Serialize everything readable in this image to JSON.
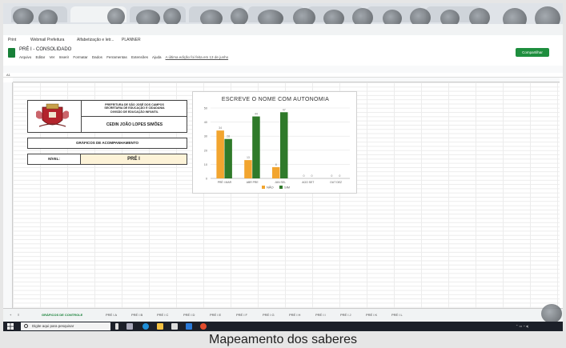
{
  "bookmarks": {
    "items": [
      "Print",
      "Webmail Prefeitura",
      "Alfabetização e letr...",
      "PLANNER"
    ]
  },
  "spreadsheet": {
    "title": "PRÉ I - CONSOLIDADO",
    "menu": [
      "Arquivo",
      "Editar",
      "Ver",
      "Inserir",
      "Formatar",
      "Dados",
      "Ferramentas",
      "Extensões",
      "Ajuda"
    ],
    "last_edit": "A última edição foi feita em 13 de junho",
    "share_label": "Compartilhar",
    "cell_ref": "A1"
  },
  "header_block": {
    "prefeitura": "PREFEITURA DE SÃO JOSÉ DOS CAMPOS",
    "secretaria": "SECRETARIA DE EDUCAÇÃO E CIDADANIA",
    "divisao": "DIVISÃO DE EDUCAÇÃO INFANTIL",
    "school": "CEDIN JOÃO LOPES SIMÕES",
    "charts_label": "GRÁFICOS DE ACOMPANHAMENTO",
    "nivel_label": "NÍVEL:",
    "nivel_value": "PRÉ I"
  },
  "chart_data": {
    "type": "bar",
    "title": "ESCREVE O NOME COM AUTONOMIA",
    "categories": [
      "PRÉ I MAR",
      "ABR PRE",
      "JUN SEL",
      "AGO SET",
      "OUT DEZ"
    ],
    "series": [
      {
        "name": "NÃO",
        "values": [
          34,
          13,
          8,
          0,
          0
        ],
        "color": "#f2a52f"
      },
      {
        "name": "SIM",
        "values": [
          28,
          44,
          47,
          0,
          0
        ],
        "color": "#2f7a2a"
      }
    ],
    "ylim": [
      0,
      50
    ],
    "yticks": [
      0,
      10,
      20,
      30,
      40,
      50
    ],
    "legend": "bottom"
  },
  "sheet_tabs": {
    "items": [
      "GRÁFICOS DE CONTROLE",
      "PRÉ I A",
      "PRÉ I B",
      "PRÉ I C",
      "PRÉ I D",
      "PRÉ I E",
      "PRÉ I F",
      "PRÉ I G",
      "PRÉ I H",
      "PRÉ I I",
      "PRÉ I J",
      "PRÉ I K",
      "PRÉ I L"
    ]
  },
  "taskbar": {
    "search_placeholder": "Digite aqui para pesquisar"
  },
  "caption": "Mapeamento dos saberes"
}
